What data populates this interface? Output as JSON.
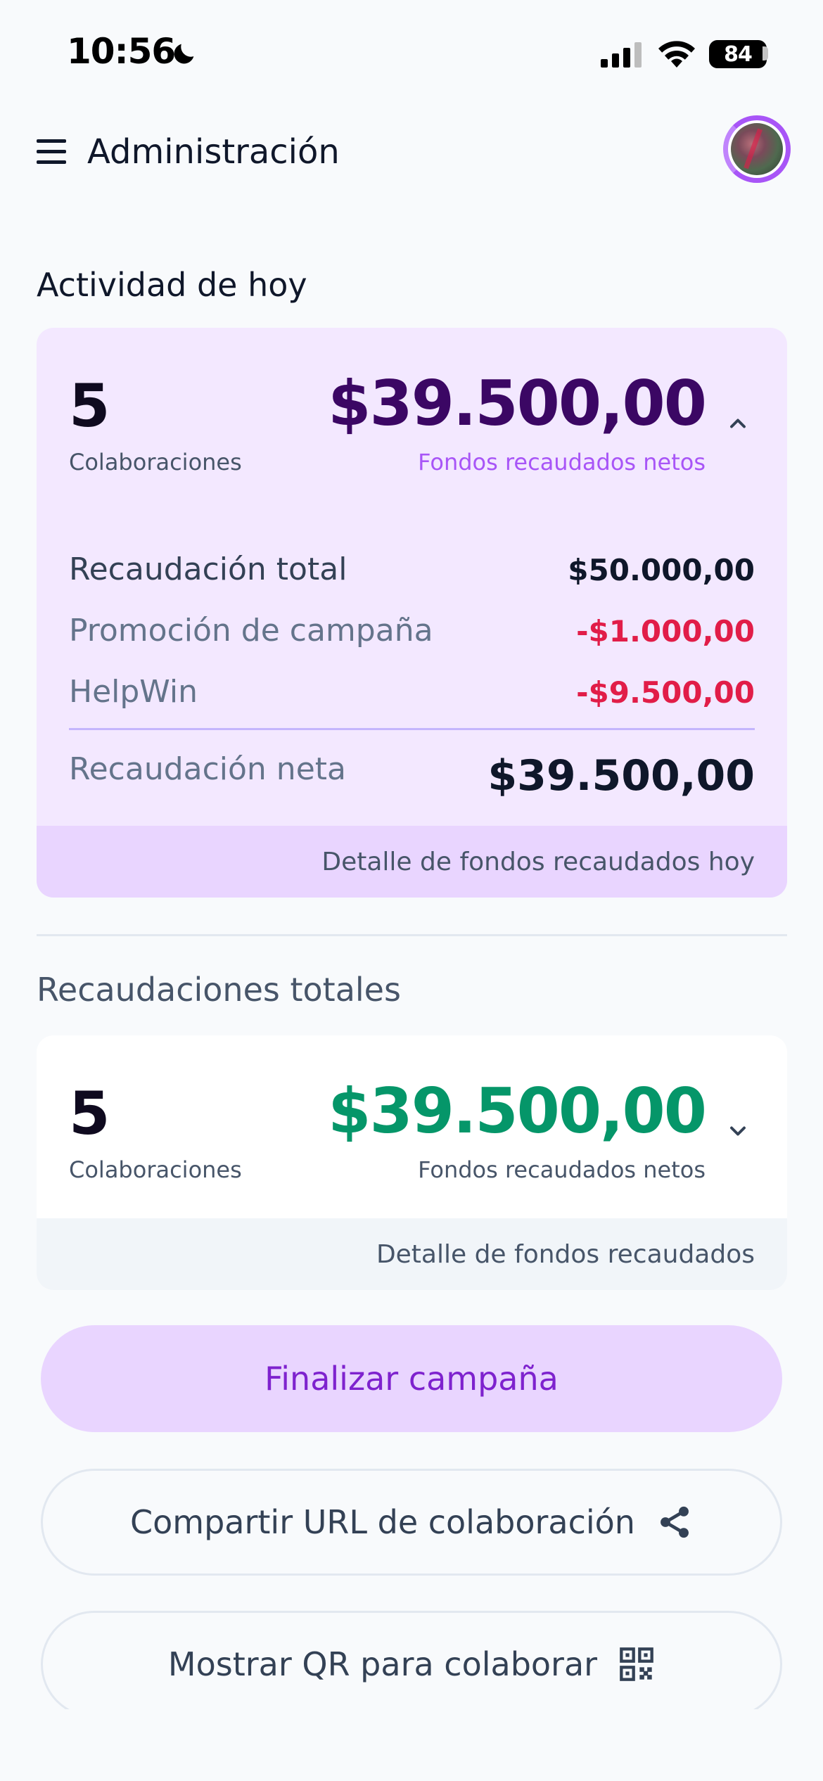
{
  "status_bar": {
    "time": "10:56",
    "battery": "84",
    "icons": [
      "moon-icon",
      "cellular-signal-icon",
      "wifi-icon",
      "battery-icon"
    ]
  },
  "header": {
    "title": "Administración",
    "menu_icon": "hamburger-menu-icon",
    "avatar": "user-avatar"
  },
  "today": {
    "section_title": "Actividad de hoy",
    "count": "5",
    "count_label": "Colaboraciones",
    "amount": "$39.500,00",
    "amount_label": "Fondos recaudados netos",
    "expanded": true,
    "breakdown": [
      {
        "label": "Recaudación total",
        "value": "$50.000,00"
      },
      {
        "label": "Promoción de campaña",
        "value": "-$1.000,00"
      },
      {
        "label": "HelpWin",
        "value": "-$9.500,00"
      }
    ],
    "net_label": "Recaudación neta",
    "net_value": "$39.500,00",
    "footer_link": "Detalle de fondos recaudados hoy"
  },
  "totals": {
    "section_title": "Recaudaciones totales",
    "count": "5",
    "count_label": "Colaboraciones",
    "amount": "$39.500,00",
    "amount_label": "Fondos recaudados netos",
    "expanded": false,
    "footer_link": "Detalle de fondos recaudados"
  },
  "actions": {
    "finish": "Finalizar campaña",
    "share": "Compartir URL de colaboración",
    "share_icon": "share-icon",
    "qr": "Mostrar QR para colaborar",
    "qr_icon": "qr-code-icon"
  },
  "colors": {
    "accent_purple": "#7e22ce",
    "amount_purple": "#3b0764",
    "amount_green": "#059669",
    "negative_red": "#e11d48",
    "card_purple_bg": "#f3e8ff"
  }
}
